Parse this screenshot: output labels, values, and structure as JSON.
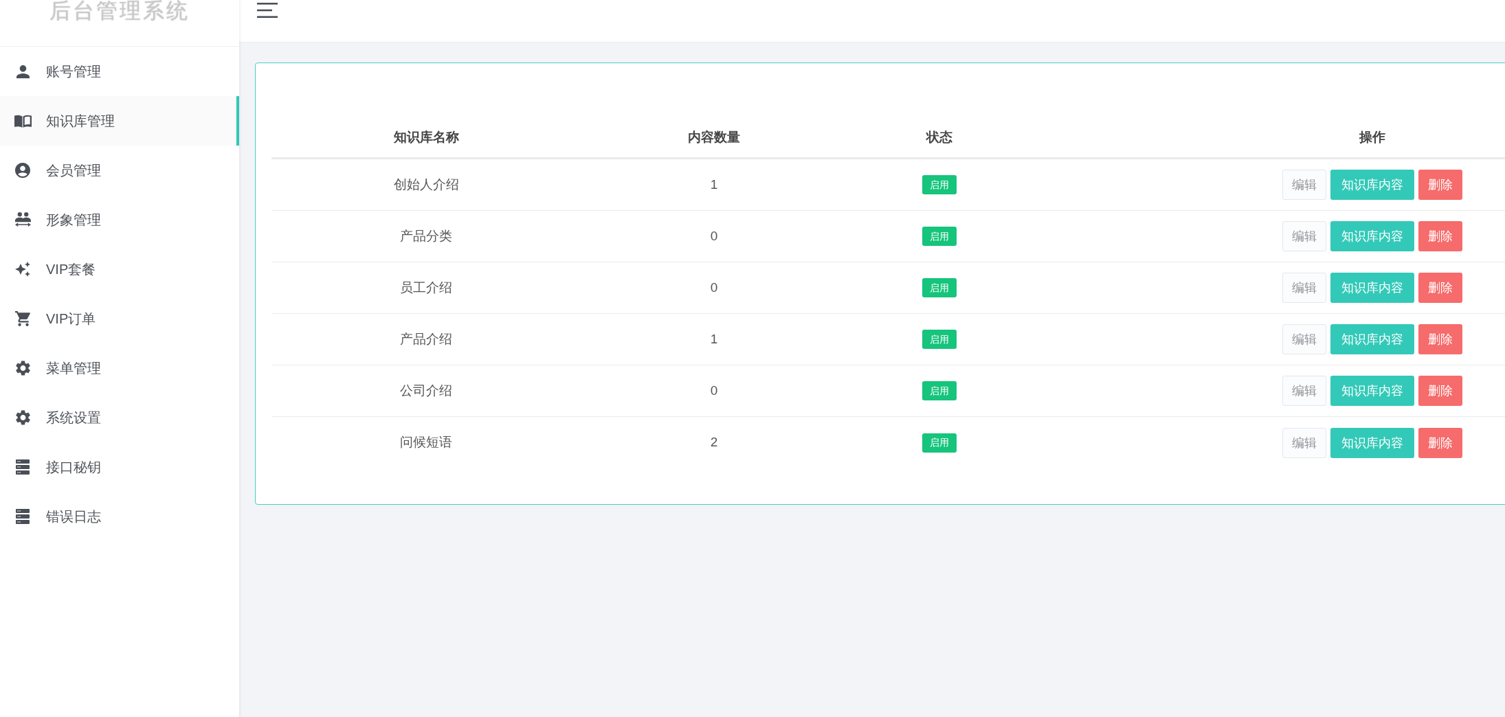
{
  "sidebar": {
    "logo": "后台管理系统",
    "items": [
      {
        "label": "账号管理",
        "selected": false
      },
      {
        "label": "知识库管理",
        "selected": true
      },
      {
        "label": "会员管理",
        "selected": false
      },
      {
        "label": "形象管理",
        "selected": false
      },
      {
        "label": "VIP套餐",
        "selected": false
      },
      {
        "label": "VIP订单",
        "selected": false
      },
      {
        "label": "菜单管理",
        "selected": false
      },
      {
        "label": "系统设置",
        "selected": false
      },
      {
        "label": "接口秘钥",
        "selected": false
      },
      {
        "label": "错误日志",
        "selected": false
      }
    ]
  },
  "table": {
    "columns": [
      "知识库名称",
      "内容数量",
      "状态",
      "操作"
    ],
    "rows": [
      {
        "name": "创始人介绍",
        "count": "1",
        "status": "启用",
        "actions": [
          {
            "kind": "plain",
            "label": "编辑"
          },
          {
            "kind": "primary",
            "label": "知识库内容"
          },
          {
            "kind": "danger",
            "label": "删除"
          }
        ]
      },
      {
        "name": "产品分类",
        "count": "0",
        "status": "启用",
        "actions": [
          {
            "kind": "plain",
            "label": "编辑"
          },
          {
            "kind": "primary",
            "label": "知识库内容"
          },
          {
            "kind": "danger",
            "label": "删除"
          }
        ]
      },
      {
        "name": "员工介绍",
        "count": "0",
        "status": "启用",
        "actions": [
          {
            "kind": "plain",
            "label": "编辑"
          },
          {
            "kind": "primary",
            "label": "知识库内容"
          },
          {
            "kind": "danger",
            "label": "删除"
          }
        ]
      },
      {
        "name": "产品介绍",
        "count": "1",
        "status": "启用",
        "actions": [
          {
            "kind": "plain",
            "label": "编辑"
          },
          {
            "kind": "primary",
            "label": "知识库内容"
          },
          {
            "kind": "danger",
            "label": "删除"
          }
        ]
      },
      {
        "name": "公司介绍",
        "count": "0",
        "status": "启用",
        "actions": [
          {
            "kind": "plain",
            "label": "编辑"
          },
          {
            "kind": "primary",
            "label": "知识库内容"
          },
          {
            "kind": "danger",
            "label": "删除"
          }
        ]
      },
      {
        "name": "问候短语",
        "count": "2",
        "status": "启用",
        "actions": [
          {
            "kind": "plain",
            "label": "编辑"
          },
          {
            "kind": "primary",
            "label": "知识库内容"
          },
          {
            "kind": "danger",
            "label": "删除"
          }
        ]
      }
    ]
  }
}
